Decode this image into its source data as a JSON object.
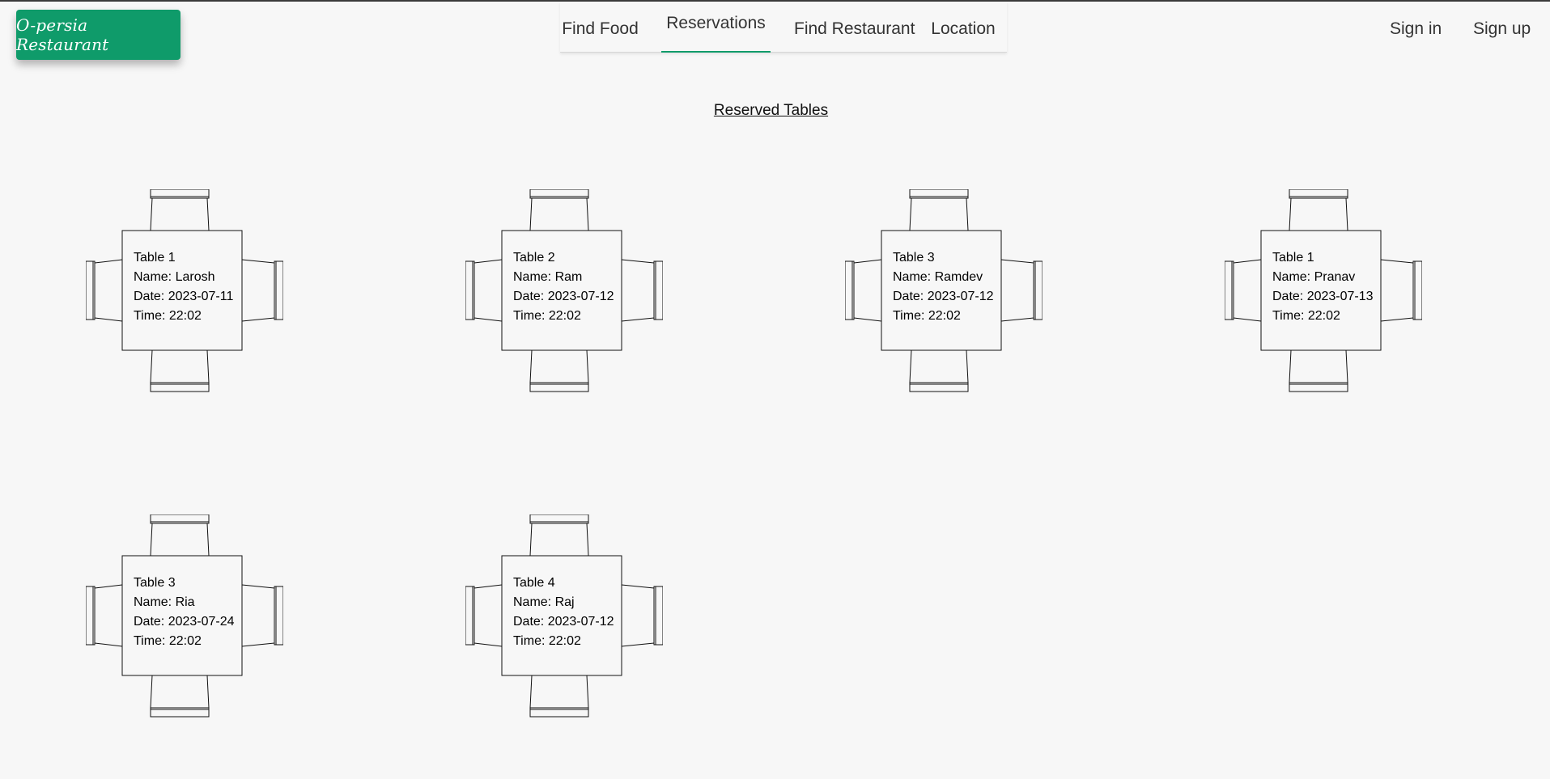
{
  "brand": {
    "name": "O-persia Restaurant",
    "color": "#0f9b6a"
  },
  "nav": {
    "items": [
      {
        "label": "Find Food",
        "active": false
      },
      {
        "label": "Reservations",
        "active": true
      },
      {
        "label": "Find Restaurant",
        "active": false
      },
      {
        "label": "Location",
        "active": false
      }
    ]
  },
  "auth": {
    "sign_in": "Sign in",
    "sign_up": "Sign up"
  },
  "page": {
    "title": "Reserved Tables"
  },
  "reservations": [
    {
      "table": "Table 1",
      "name": "Name: Larosh",
      "date": "Date: 2023-07-11",
      "time": "Time: 22:02"
    },
    {
      "table": "Table 2",
      "name": "Name: Ram",
      "date": "Date: 2023-07-12",
      "time": "Time: 22:02"
    },
    {
      "table": "Table 3",
      "name": "Name: Ramdev",
      "date": "Date: 2023-07-12",
      "time": "Time: 22:02"
    },
    {
      "table": "Table 1",
      "name": "Name: Pranav",
      "date": "Date: 2023-07-13",
      "time": "Time: 22:02"
    },
    {
      "table": "Table 3",
      "name": "Name: Ria",
      "date": "Date: 2023-07-24",
      "time": "Time: 22:02"
    },
    {
      "table": "Table 4",
      "name": "Name: Raj",
      "date": "Date: 2023-07-12",
      "time": "Time: 22:02"
    }
  ]
}
